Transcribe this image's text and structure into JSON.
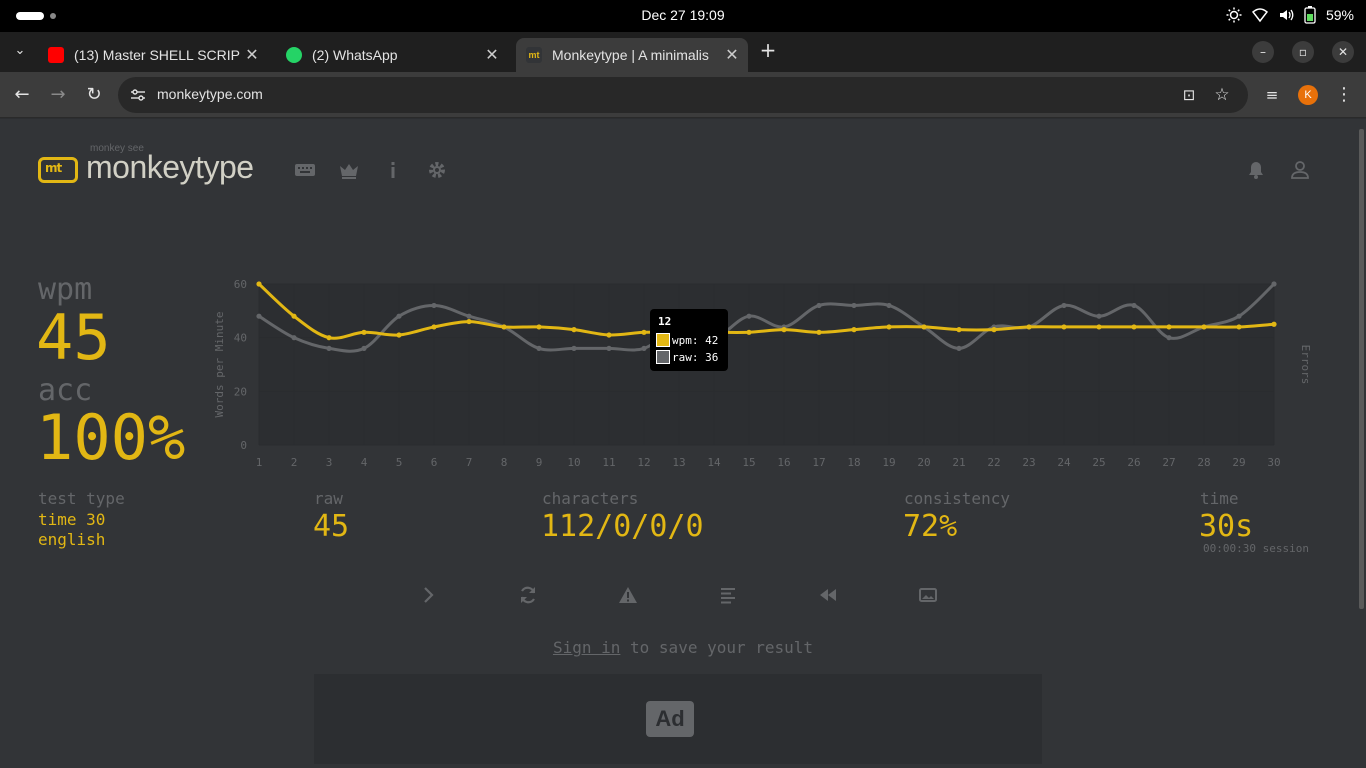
{
  "system_bar": {
    "datetime": "Dec 27  19:09",
    "battery": "59%"
  },
  "tabs": [
    {
      "title": "(13) Master SHELL SCRIP",
      "favicon": "youtube-icon",
      "color": "#ff0000"
    },
    {
      "title": "(2) WhatsApp",
      "favicon": "whatsapp-icon",
      "color": "#25d366"
    },
    {
      "title": "Monkeytype | A minimalis",
      "favicon": "monkeytype-icon",
      "color": "#e2b714"
    }
  ],
  "address_bar": {
    "url": "monkeytype.com",
    "profile_initial": "K"
  },
  "header": {
    "logo_sub": "monkey see",
    "logo_text": "monkeytype",
    "logo_mark": "mt"
  },
  "stats": {
    "wpm_label": "wpm",
    "wpm": "45",
    "acc_label": "acc",
    "acc": "100%",
    "test_type_label": "test type",
    "test_type_line1": "time 30",
    "test_type_line2": "english",
    "raw_label": "raw",
    "raw": "45",
    "characters_label": "characters",
    "characters": "112/0/0/0",
    "consistency_label": "consistency",
    "consistency": "72%",
    "time_label": "time",
    "time": "30s",
    "session": "00:00:30 session"
  },
  "chart_data": {
    "type": "line",
    "x": [
      1,
      2,
      3,
      4,
      5,
      6,
      7,
      8,
      9,
      10,
      11,
      12,
      13,
      14,
      15,
      16,
      17,
      18,
      19,
      20,
      21,
      22,
      23,
      24,
      25,
      26,
      27,
      28,
      29,
      30
    ],
    "series": [
      {
        "name": "wpm",
        "color": "#e2b714",
        "values": [
          60,
          48,
          40,
          42,
          41,
          44,
          46,
          44,
          44,
          43,
          41,
          42,
          42,
          42,
          42,
          43,
          42,
          43,
          44,
          44,
          43,
          43,
          44,
          44,
          44,
          44,
          44,
          44,
          44,
          45
        ]
      },
      {
        "name": "raw",
        "color": "#646669",
        "values": [
          48,
          40,
          36,
          36,
          48,
          52,
          48,
          44,
          36,
          36,
          36,
          36,
          44,
          40,
          48,
          44,
          52,
          52,
          52,
          44,
          36,
          44,
          44,
          52,
          48,
          52,
          40,
          44,
          48,
          60
        ]
      }
    ],
    "ylabel": "Words per Minute",
    "y2label": "Errors",
    "yticks": [
      0,
      20,
      40,
      60
    ],
    "ylim": [
      0,
      60
    ],
    "tooltip": {
      "title": "12",
      "wpm_text": "wpm: 42",
      "raw_text": "raw: 36"
    }
  },
  "result_buttons": [
    "next-test",
    "restart-test",
    "report-words",
    "word-history",
    "replay",
    "screenshot"
  ],
  "signin": {
    "link": "Sign in",
    "rest": " to save your result"
  },
  "ad": {
    "label": "Ad"
  }
}
